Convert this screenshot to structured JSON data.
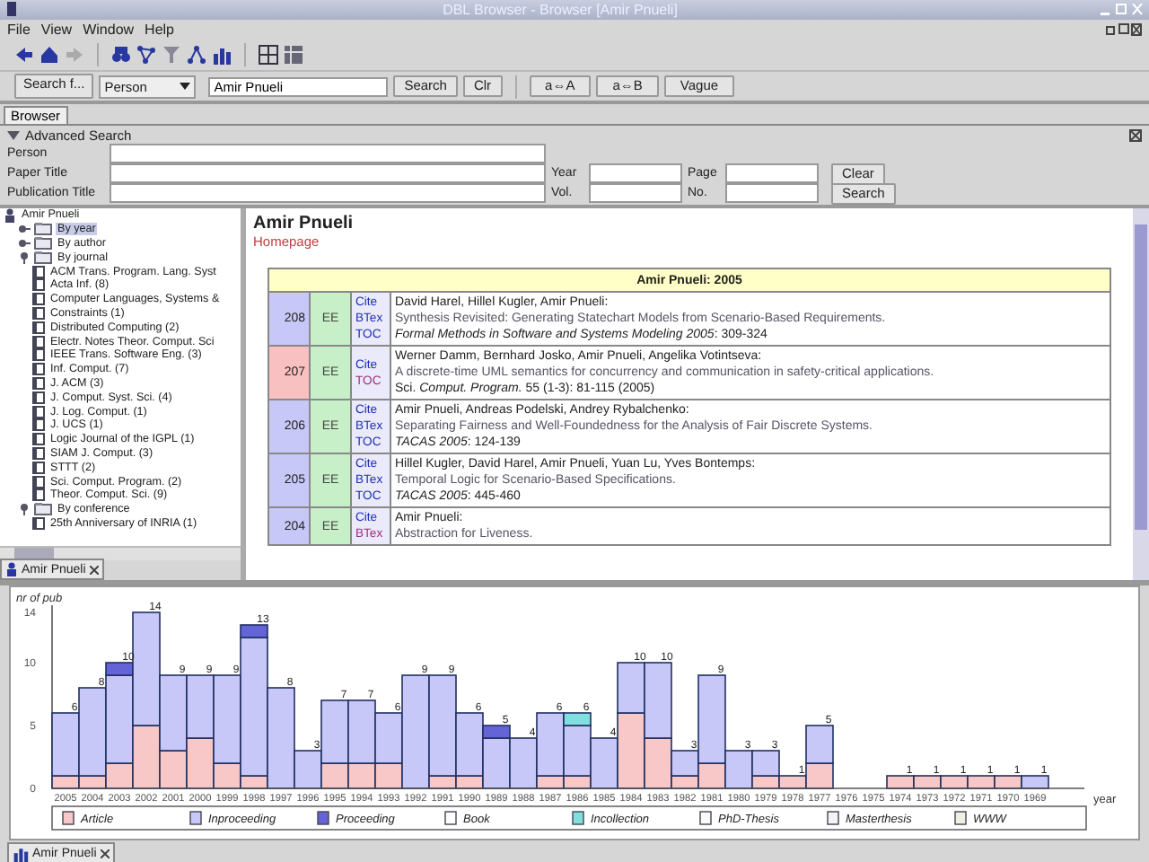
{
  "window": {
    "title": "DBL Browser - Browser [Amir Pnueli]"
  },
  "menu": [
    "File",
    "View",
    "Window",
    "Help"
  ],
  "search_bar": {
    "label": "Search f...",
    "type": "Person",
    "value": "Amir Pnueli",
    "buttons": [
      "Search",
      "Clr",
      "a⇔A",
      "a⇔B",
      "Vague"
    ]
  },
  "tabs": [
    {
      "label": "Browser",
      "selected": true
    }
  ],
  "advanced_search": {
    "title": "Advanced Search",
    "expanded": true,
    "rows": [
      [
        {
          "kind": "field",
          "label": "Person"
        }
      ],
      [
        {
          "kind": "field",
          "label": "Paper Title"
        },
        {
          "kind": "field",
          "label": "Year"
        },
        {
          "kind": "field",
          "label": "Page"
        },
        {
          "kind": "button",
          "label": "Clear"
        }
      ],
      [
        {
          "kind": "field",
          "label": "Publication Title"
        },
        {
          "kind": "field",
          "label": "Vol."
        },
        {
          "kind": "field",
          "label": "No."
        },
        {
          "kind": "button",
          "label": "Search"
        }
      ]
    ]
  },
  "tree": {
    "items": [
      {
        "label": "Amir Pnueli",
        "children": [
          {
            "label": "By year",
            "selected": true,
            "expanded": false
          },
          {
            "label": "By author",
            "selected": false,
            "expanded": false
          },
          {
            "label": "By journal",
            "selected": false,
            "expanded": true,
            "children": [
              {
                "label": "ACM Trans. Program. Lang. Syst",
                "selected": false
              },
              {
                "label": "Acta Inf. (8)",
                "selected": false
              },
              {
                "label": "Computer Languages, Systems &",
                "selected": false
              },
              {
                "label": "Constraints (1)",
                "selected": false
              },
              {
                "label": "Distributed Computing (2)",
                "selected": false
              },
              {
                "label": "Electr. Notes Theor. Comput. Sci",
                "selected": false
              },
              {
                "label": "IEEE Trans. Software Eng. (3)",
                "selected": false
              },
              {
                "label": "Inf. Comput. (7)",
                "selected": false
              },
              {
                "label": "J. ACM (3)",
                "selected": false
              },
              {
                "label": "J. Comput. Syst. Sci. (4)",
                "selected": false
              },
              {
                "label": "J. Log. Comput. (1)",
                "selected": false
              },
              {
                "label": "J. UCS (1)",
                "selected": false
              },
              {
                "label": "Logic Journal of the IGPL (1)",
                "selected": false
              },
              {
                "label": "SIAM J. Comput. (3)",
                "selected": false
              },
              {
                "label": "STTT (2)",
                "selected": false
              },
              {
                "label": "Sci. Comput. Program. (2)",
                "selected": false
              },
              {
                "label": "Theor. Comput. Sci. (9)",
                "selected": false
              }
            ]
          },
          {
            "label": "By conference",
            "selected": false,
            "expanded": true,
            "children": [
              {
                "label": "25th Anniversary of INRIA (1)",
                "selected": false
              }
            ]
          }
        ]
      }
    ]
  },
  "tree_tab": {
    "label": "Amir Pnueli"
  },
  "content": {
    "heading": "Amir Pnueli",
    "link": "Homepage",
    "table": {
      "title": "Amir Pnueli: 2005",
      "rows": [
        {
          "number": "208",
          "kind": "inproceedings",
          "ee": "EE",
          "links": [
            "Cite",
            "BTex",
            "TOC"
          ],
          "authors": "David Harel, Hillel Kugler, Amir Pnueli:",
          "title": "Synthesis Revisited: Generating Statechart Models from Scenario-Based Requirements.",
          "venue": "*Formal Methods in Software and Systems Modeling 2005*: 309-324"
        },
        {
          "number": "207",
          "kind": "article",
          "ee": "EE",
          "links": [
            "Cite",
            "TOC"
          ],
          "authors": "Werner Damm, Bernhard Josko, Amir Pnueli, Angelika Votintseva:",
          "title": "A discrete-time UML semantics for concurrency and communication in safety-critical applications.",
          "venue": "Sci. *Comput. Program.* 55 (1-3): 81-115 (2005)"
        },
        {
          "number": "206",
          "kind": "inproceedings",
          "ee": "EE",
          "links": [
            "Cite",
            "BTex",
            "TOC"
          ],
          "authors": "Amir Pnueli, Andreas Podelski, Andrey Rybalchenko:",
          "title": "Separating Fairness and Well-Foundedness for the Analysis of Fair Discrete Systems.",
          "venue": "*TACAS 2005*: 124-139"
        },
        {
          "number": "205",
          "kind": "inproceedings",
          "ee": "EE",
          "links": [
            "Cite",
            "BTex",
            "TOC"
          ],
          "authors": "Hillel Kugler, David Harel, Amir Pnueli, Yuan Lu, Yves Bontemps:",
          "title": "Temporal Logic for Scenario-Based Specifications.",
          "venue": "*TACAS 2005*: 445-460"
        },
        {
          "number": "204",
          "kind": "inproceedings",
          "ee": "EE",
          "links": [
            "Cite",
            "BTex"
          ],
          "authors": "Amir Pnueli:",
          "title": "Abstraction for Liveness."
        }
      ]
    }
  },
  "chart_panel": {
    "tab": "Amir Pnueli",
    "chart_data": {
      "type": "bar",
      "stacked": true,
      "ylabel": "nr of pub",
      "xlabel": "year",
      "legend": "bottom",
      "ylim": [
        0,
        14
      ],
      "yticks": [
        0,
        5,
        10,
        14
      ],
      "annotations": [
        {
          "x": "2005",
          "y": 6,
          "text": "6"
        },
        {
          "x": "2004",
          "y": 8,
          "text": "8"
        },
        {
          "x": "2003",
          "y": 10,
          "text": "10"
        },
        {
          "x": "2002",
          "y": 14,
          "text": "14"
        },
        {
          "x": "2001",
          "y": 9,
          "text": "9"
        },
        {
          "x": "2000",
          "y": 9,
          "text": "9"
        },
        {
          "x": "1999",
          "y": 9,
          "text": "9"
        },
        {
          "x": "1998",
          "y": 13,
          "text": "13"
        },
        {
          "x": "1997",
          "y": 8,
          "text": "8"
        },
        {
          "x": "1996",
          "y": 3,
          "text": "3"
        },
        {
          "x": "1995",
          "y": 7,
          "text": "7"
        },
        {
          "x": "1994",
          "y": 7,
          "text": "7"
        },
        {
          "x": "1993",
          "y": 6,
          "text": "6"
        },
        {
          "x": "1992",
          "y": 9,
          "text": "9"
        },
        {
          "x": "1991",
          "y": 9,
          "text": "9"
        },
        {
          "x": "1990",
          "y": 6,
          "text": "6"
        },
        {
          "x": "1989",
          "y": 5,
          "text": "5"
        },
        {
          "x": "1988",
          "y": 4,
          "text": "4"
        },
        {
          "x": "1987",
          "y": 6,
          "text": "6"
        },
        {
          "x": "1986",
          "y": 6,
          "text": "6"
        },
        {
          "x": "1985",
          "y": 4,
          "text": "4"
        },
        {
          "x": "1984",
          "y": 10,
          "text": "10"
        },
        {
          "x": "1983",
          "y": 10,
          "text": "10"
        },
        {
          "x": "1982",
          "y": 3,
          "text": "3"
        },
        {
          "x": "1981",
          "y": 9,
          "text": "9"
        },
        {
          "x": "1980",
          "y": 3,
          "text": "3"
        },
        {
          "x": "1979",
          "y": 3,
          "text": "3"
        },
        {
          "x": "1978",
          "y": 1,
          "text": "1"
        },
        {
          "x": "1977",
          "y": 5,
          "text": "5"
        },
        {
          "x": "1974",
          "y": 1,
          "text": "1"
        },
        {
          "x": "1973",
          "y": 1,
          "text": "1"
        },
        {
          "x": "1972",
          "y": 1,
          "text": "1"
        },
        {
          "x": "1971",
          "y": 1,
          "text": "1"
        },
        {
          "x": "1970",
          "y": 1,
          "text": "1"
        },
        {
          "x": "1969",
          "y": 1,
          "text": "1"
        }
      ],
      "categories": [
        "2005",
        "2004",
        "2003",
        "2002",
        "2001",
        "2000",
        "1999",
        "1998",
        "1997",
        "1996",
        "1995",
        "1994",
        "1993",
        "1992",
        "1991",
        "1990",
        "1989",
        "1988",
        "1987",
        "1986",
        "1985",
        "1984",
        "1983",
        "1982",
        "1981",
        "1980",
        "1979",
        "1978",
        "1977",
        "1976",
        "1975",
        "1974",
        "1973",
        "1972",
        "1971",
        "1970",
        "1969"
      ],
      "series": [
        {
          "name": "Article",
          "color": "#f8c8c8",
          "values": [
            1,
            1,
            2,
            5,
            3,
            4,
            2,
            1,
            0,
            0,
            2,
            2,
            2,
            0,
            1,
            1,
            0,
            0,
            1,
            1,
            0,
            6,
            4,
            1,
            2,
            0,
            1,
            1,
            2,
            0,
            0,
            1,
            1,
            1,
            1,
            1,
            0
          ]
        },
        {
          "name": "Inproceeding",
          "color": "#c8c8f8",
          "values": [
            5,
            7,
            7,
            9,
            6,
            5,
            7,
            11,
            8,
            3,
            5,
            5,
            4,
            9,
            8,
            5,
            4,
            4,
            5,
            4,
            4,
            4,
            6,
            2,
            7,
            3,
            2,
            0,
            3,
            0,
            0,
            0,
            0,
            0,
            0,
            0,
            1
          ]
        },
        {
          "name": "Proceeding",
          "color": "#6464d8",
          "values": [
            0,
            0,
            1,
            0,
            0,
            0,
            0,
            1,
            0,
            0,
            0,
            0,
            0,
            0,
            0,
            0,
            1,
            0,
            0,
            0,
            0,
            0,
            0,
            0,
            0,
            0,
            0,
            0,
            0,
            0,
            0,
            0,
            0,
            0,
            0,
            0,
            0
          ]
        },
        {
          "name": "Book",
          "color": "#ffffff",
          "values": [
            0,
            0,
            0,
            0,
            0,
            0,
            0,
            0,
            0,
            0,
            0,
            0,
            0,
            0,
            0,
            0,
            0,
            0,
            0,
            0,
            0,
            0,
            0,
            0,
            0,
            0,
            0,
            0,
            0,
            0,
            0,
            0,
            0,
            0,
            0,
            0,
            0
          ]
        },
        {
          "name": "Incollection",
          "color": "#80e0e0",
          "values": [
            0,
            0,
            0,
            0,
            0,
            0,
            0,
            0,
            0,
            0,
            0,
            0,
            0,
            0,
            0,
            0,
            0,
            0,
            0,
            1,
            0,
            0,
            0,
            0,
            0,
            0,
            0,
            0,
            0,
            0,
            0,
            0,
            0,
            0,
            0,
            0,
            0
          ]
        },
        {
          "name": "PhD-Thesis",
          "color": "#fafafa",
          "values": [
            0,
            0,
            0,
            0,
            0,
            0,
            0,
            0,
            0,
            0,
            0,
            0,
            0,
            0,
            0,
            0,
            0,
            0,
            0,
            0,
            0,
            0,
            0,
            0,
            0,
            0,
            0,
            0,
            0,
            0,
            0,
            0,
            0,
            0,
            0,
            0,
            0
          ]
        },
        {
          "name": "Masterthesis",
          "color": "#f4f4f4",
          "values": [
            0,
            0,
            0,
            0,
            0,
            0,
            0,
            0,
            0,
            0,
            0,
            0,
            0,
            0,
            0,
            0,
            0,
            0,
            0,
            0,
            0,
            0,
            0,
            0,
            0,
            0,
            0,
            0,
            0,
            0,
            0,
            0,
            0,
            0,
            0,
            0,
            0
          ]
        },
        {
          "name": "WWW",
          "color": "#f0f0e0",
          "values": [
            0,
            0,
            0,
            0,
            0,
            0,
            0,
            0,
            0,
            0,
            0,
            0,
            0,
            0,
            0,
            0,
            0,
            0,
            0,
            0,
            0,
            0,
            0,
            0,
            0,
            0,
            0,
            0,
            0,
            0,
            0,
            0,
            0,
            0,
            0,
            0,
            0
          ]
        }
      ]
    }
  }
}
